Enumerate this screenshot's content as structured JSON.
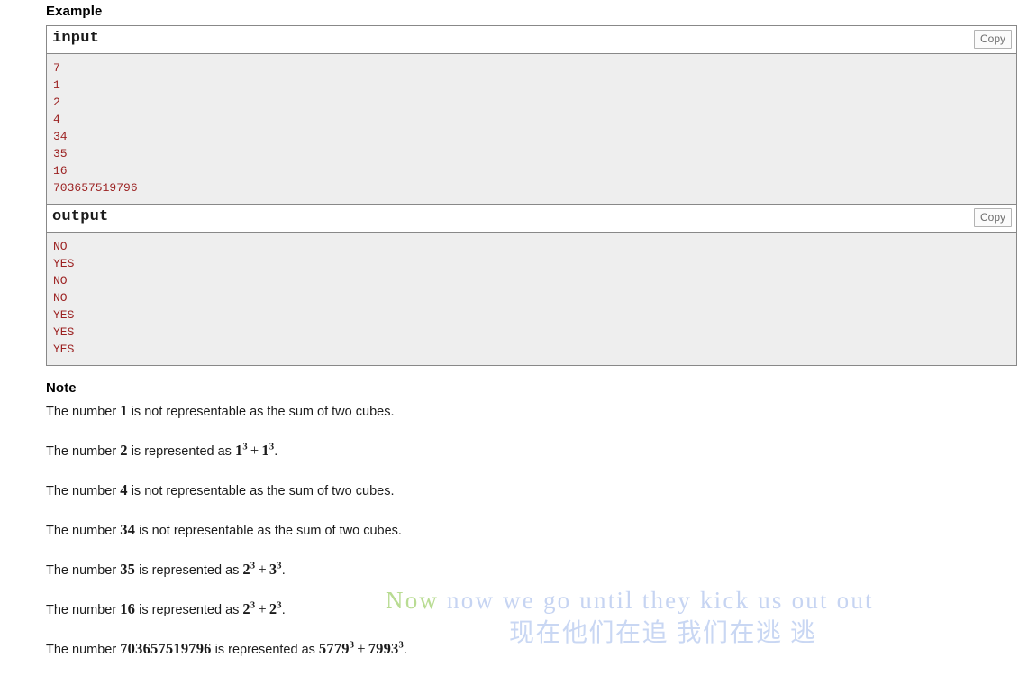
{
  "heading": {
    "example_title": "Example",
    "note_title": "Note"
  },
  "sample_tests": [
    {
      "label": "input",
      "copy_label": "Copy",
      "lines": [
        "7",
        "1",
        "2",
        "4",
        "34",
        "35",
        "16",
        "703657519796"
      ]
    },
    {
      "label": "output",
      "copy_label": "Copy",
      "lines": [
        "NO",
        "YES",
        "NO",
        "NO",
        "YES",
        "YES",
        "YES"
      ]
    }
  ],
  "note": {
    "lines": [
      {
        "prefix": "The number ",
        "number": "1",
        "middle": " is not representable as the sum of two cubes.",
        "expr": "",
        "suffix": ""
      },
      {
        "prefix": "The number ",
        "number": "2",
        "middle": " is represented as ",
        "expr_a_base": "1",
        "expr_a_exp": "3",
        "expr_op": "+",
        "expr_b_base": "1",
        "expr_b_exp": "3",
        "suffix": "."
      },
      {
        "prefix": "The number ",
        "number": "4",
        "middle": " is not representable as the sum of two cubes.",
        "expr": "",
        "suffix": ""
      },
      {
        "prefix": "The number ",
        "number": "34",
        "middle": " is not representable as the sum of two cubes.",
        "expr": "",
        "suffix": ""
      },
      {
        "prefix": "The number ",
        "number": "35",
        "middle": " is represented as ",
        "expr_a_base": "2",
        "expr_a_exp": "3",
        "expr_op": "+",
        "expr_b_base": "3",
        "expr_b_exp": "3",
        "suffix": "."
      },
      {
        "prefix": "The number ",
        "number": "16",
        "middle": " is represented as ",
        "expr_a_base": "2",
        "expr_a_exp": "3",
        "expr_op": "+",
        "expr_b_base": "2",
        "expr_b_exp": "3",
        "suffix": "."
      },
      {
        "prefix": "The number ",
        "number": "703657519796",
        "middle": " is represented as ",
        "expr_a_base": "5779",
        "expr_a_exp": "3",
        "expr_op": "+",
        "expr_b_base": "7993",
        "expr_b_exp": "3",
        "suffix": "."
      }
    ]
  },
  "overlay": {
    "english_first_word": "Now",
    "english_rest": " now we go until they kick us out out",
    "chinese": "现在他们在追 我们在逃 逃",
    "color_first_word": "#b9dc93",
    "color_rest": "#c6d4f2",
    "color_chinese": "#c9d7f3"
  },
  "colors": {
    "sample_text": "#9c2222",
    "sample_bg": "#eeeeee",
    "border": "#888888"
  }
}
